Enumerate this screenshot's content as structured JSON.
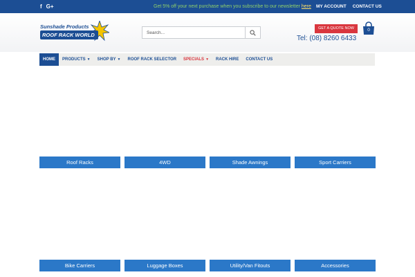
{
  "topbar": {
    "social": {
      "facebook_glyph": "f",
      "google_glyph": "G+"
    },
    "promo_text": "Get 5% off your next purchase when you subscribe to our newsletter ",
    "promo_link": "here",
    "links": [
      "MY ACCOUNT",
      "CONTACT US"
    ]
  },
  "header": {
    "logo": {
      "line1": "Sunshade Products",
      "line2": "ROOF RACK WORLD"
    },
    "search": {
      "placeholder": "Search..."
    },
    "quote_button": "GET A QUOTE NOW",
    "phone": "Tel: (08) 8260 6433",
    "cart_count": "0"
  },
  "nav": {
    "home": "HOME",
    "products": "PRODUCTS",
    "shop_by": "SHOP BY",
    "roof_rack_selector": "ROOF RACK SELECTOR",
    "specials": "SPECIALS",
    "rack_hire": "RACK HIRE",
    "contact_us": "CONTACT US"
  },
  "categories": [
    "Roof Racks",
    "4WD",
    "Shade Awnings",
    "Sport Carriers",
    "Bike Carriers",
    "Luggage Boxes",
    "Utility/Van Fitouts",
    "Accessories"
  ],
  "colors": {
    "brand_blue": "#1c4e94",
    "tile_blue": "#2b78c8",
    "accent_red": "#d9363e",
    "promo_green": "#8fcf6a"
  }
}
